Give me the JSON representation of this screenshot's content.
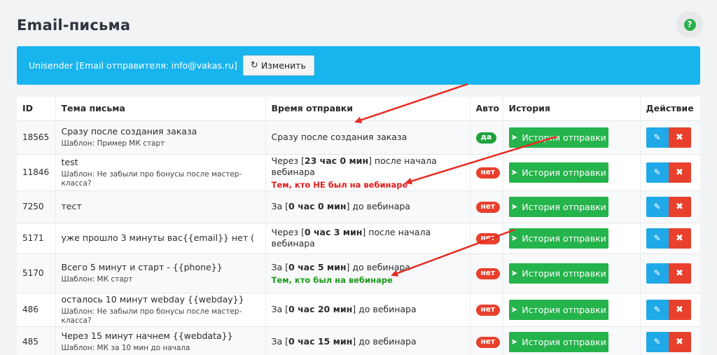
{
  "page": {
    "title": "Email-письма"
  },
  "help": {
    "label": "?"
  },
  "banner": {
    "text": "Unisender [Email отправителя: info@vakas.ru]",
    "change_label": "Изменить",
    "color": "#17b4ee"
  },
  "table": {
    "headers": {
      "id": "ID",
      "subject": "Тема письма",
      "time": "Время отправки",
      "auto": "Авто",
      "history": "История",
      "action": "Действие"
    },
    "history_label": "История отправки",
    "rows": [
      {
        "id": "18565",
        "subject": "Сразу после создания заказа",
        "template": "Шаблон: Пример МК старт",
        "time_pre": "Сразу после создания заказа",
        "time_bold": "",
        "time_post": "",
        "segment": "",
        "segment_type": "",
        "auto": "да",
        "auto_type": "yes"
      },
      {
        "id": "11846",
        "subject": "test",
        "template": "Шаблон: Не забыли про бонусы после мастер-класса?",
        "time_pre": "Через [",
        "time_bold": "23 час 0 мин",
        "time_post": "] после начала вебинара",
        "segment": "Тем, кто НЕ был на вебинаре",
        "segment_type": "red",
        "auto": "нет",
        "auto_type": "no"
      },
      {
        "id": "7250",
        "subject": "тест",
        "template": "",
        "time_pre": "За [",
        "time_bold": "0 час 0 мин",
        "time_post": "] до вебинара",
        "segment": "",
        "segment_type": "",
        "auto": "нет",
        "auto_type": "no"
      },
      {
        "id": "5171",
        "subject": "уже прошло 3 минуты вас{{email}} нет (",
        "template": "",
        "time_pre": "Через [",
        "time_bold": "0 час 3 мин",
        "time_post": "] после начала вебинара",
        "segment": "",
        "segment_type": "",
        "auto": "нет",
        "auto_type": "no"
      },
      {
        "id": "5170",
        "subject": "Всего 5 минут и старт - {{phone}}",
        "template": "Шаблон: МК старт",
        "time_pre": "За [",
        "time_bold": "0 час 5 мин",
        "time_post": "] до вебинара",
        "segment": "Тем, кто был на вебинаре",
        "segment_type": "green",
        "auto": "нет",
        "auto_type": "no"
      },
      {
        "id": "486",
        "subject": "осталось 10 минут webday {{webday}}",
        "template": "Шаблон: Не забыли про бонусы после мастер-класса?",
        "time_pre": "За [",
        "time_bold": "0 час 20 мин",
        "time_post": "] до вебинара",
        "segment": "",
        "segment_type": "",
        "auto": "нет",
        "auto_type": "no"
      },
      {
        "id": "485",
        "subject": "Через 15 минут начнем {{webdata}}",
        "template": "Шаблон: МК за 10 мин до начала",
        "time_pre": "За [",
        "time_bold": "0 час 15 мин",
        "time_post": "] до вебинара",
        "segment": "",
        "segment_type": "",
        "auto": "нет",
        "auto_type": "no"
      }
    ]
  },
  "icons": {
    "help": "question-icon",
    "refresh": "refresh-icon",
    "history": "paper-plane-icon",
    "edit": "pencil-icon",
    "delete": "close-icon"
  },
  "colors": {
    "green": "#25b34b",
    "red": "#e8402d",
    "blue": "#1fa9e8",
    "annotation": "#e62b22"
  }
}
